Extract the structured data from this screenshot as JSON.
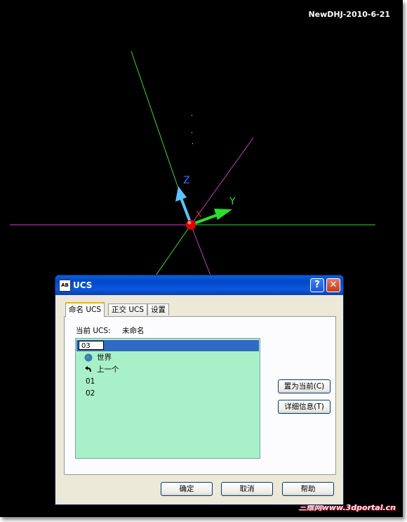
{
  "caption": "NewDHJ-2010-6-21",
  "watermark": "三维网www.3dportal.cn",
  "axes": {
    "x": "X",
    "y": "Y",
    "z": "Z"
  },
  "dialog": {
    "title": "UCS",
    "title_help_glyph": "?",
    "title_close_glyph": "✕",
    "app_icon_text": "AB",
    "tabs": [
      {
        "label": "命名 UCS",
        "active": true
      },
      {
        "label": "正交 UCS",
        "active": false
      },
      {
        "label": "设置",
        "active": false
      }
    ],
    "current_ucs_label": "当前 UCS:",
    "current_ucs_value": "未命名",
    "list_items": [
      {
        "label": "03",
        "icon": "text-cursor-icon",
        "selected": true,
        "editing": true
      },
      {
        "label": "世界",
        "icon": "globe-icon"
      },
      {
        "label": "上一个",
        "icon": "undo-arrow-icon"
      },
      {
        "label": "01",
        "icon": ""
      },
      {
        "label": "02",
        "icon": ""
      }
    ],
    "buttons": {
      "set_current": "置为当前(C)",
      "details": "详细信息(T)",
      "ok": "确定",
      "cancel": "取消",
      "help": "帮助"
    },
    "colors": {
      "list_bg": "#a8f0c8",
      "selection": "#316ac5",
      "title_bar": "#0546c9"
    }
  }
}
